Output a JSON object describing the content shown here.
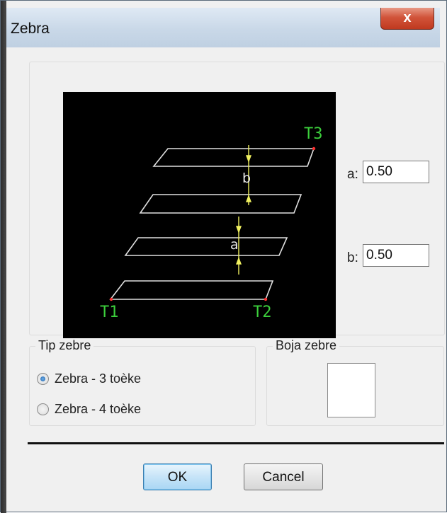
{
  "window": {
    "title": "Zebra",
    "close_glyph": "x"
  },
  "preview": {
    "labels": {
      "t1": "T1",
      "t2": "T2",
      "t3": "T3",
      "b": "b",
      "a": "a"
    },
    "colors": {
      "background": "#000000",
      "stripe": "#e0e0e0",
      "text": "#3ccf3c",
      "marker": "#f0f060"
    }
  },
  "params": {
    "a_label": "a:",
    "a_value": "0.50",
    "b_label": "b:",
    "b_value": "0.50"
  },
  "tip_zebre": {
    "title": "Tip zebre",
    "options": [
      {
        "label": "Zebra - 3 toèke",
        "checked": true
      },
      {
        "label": "Zebra - 4 toèke",
        "checked": false
      }
    ]
  },
  "boja_zebre": {
    "title": "Boja zebre",
    "color": "#ffffff"
  },
  "buttons": {
    "ok": "OK",
    "cancel": "Cancel"
  }
}
